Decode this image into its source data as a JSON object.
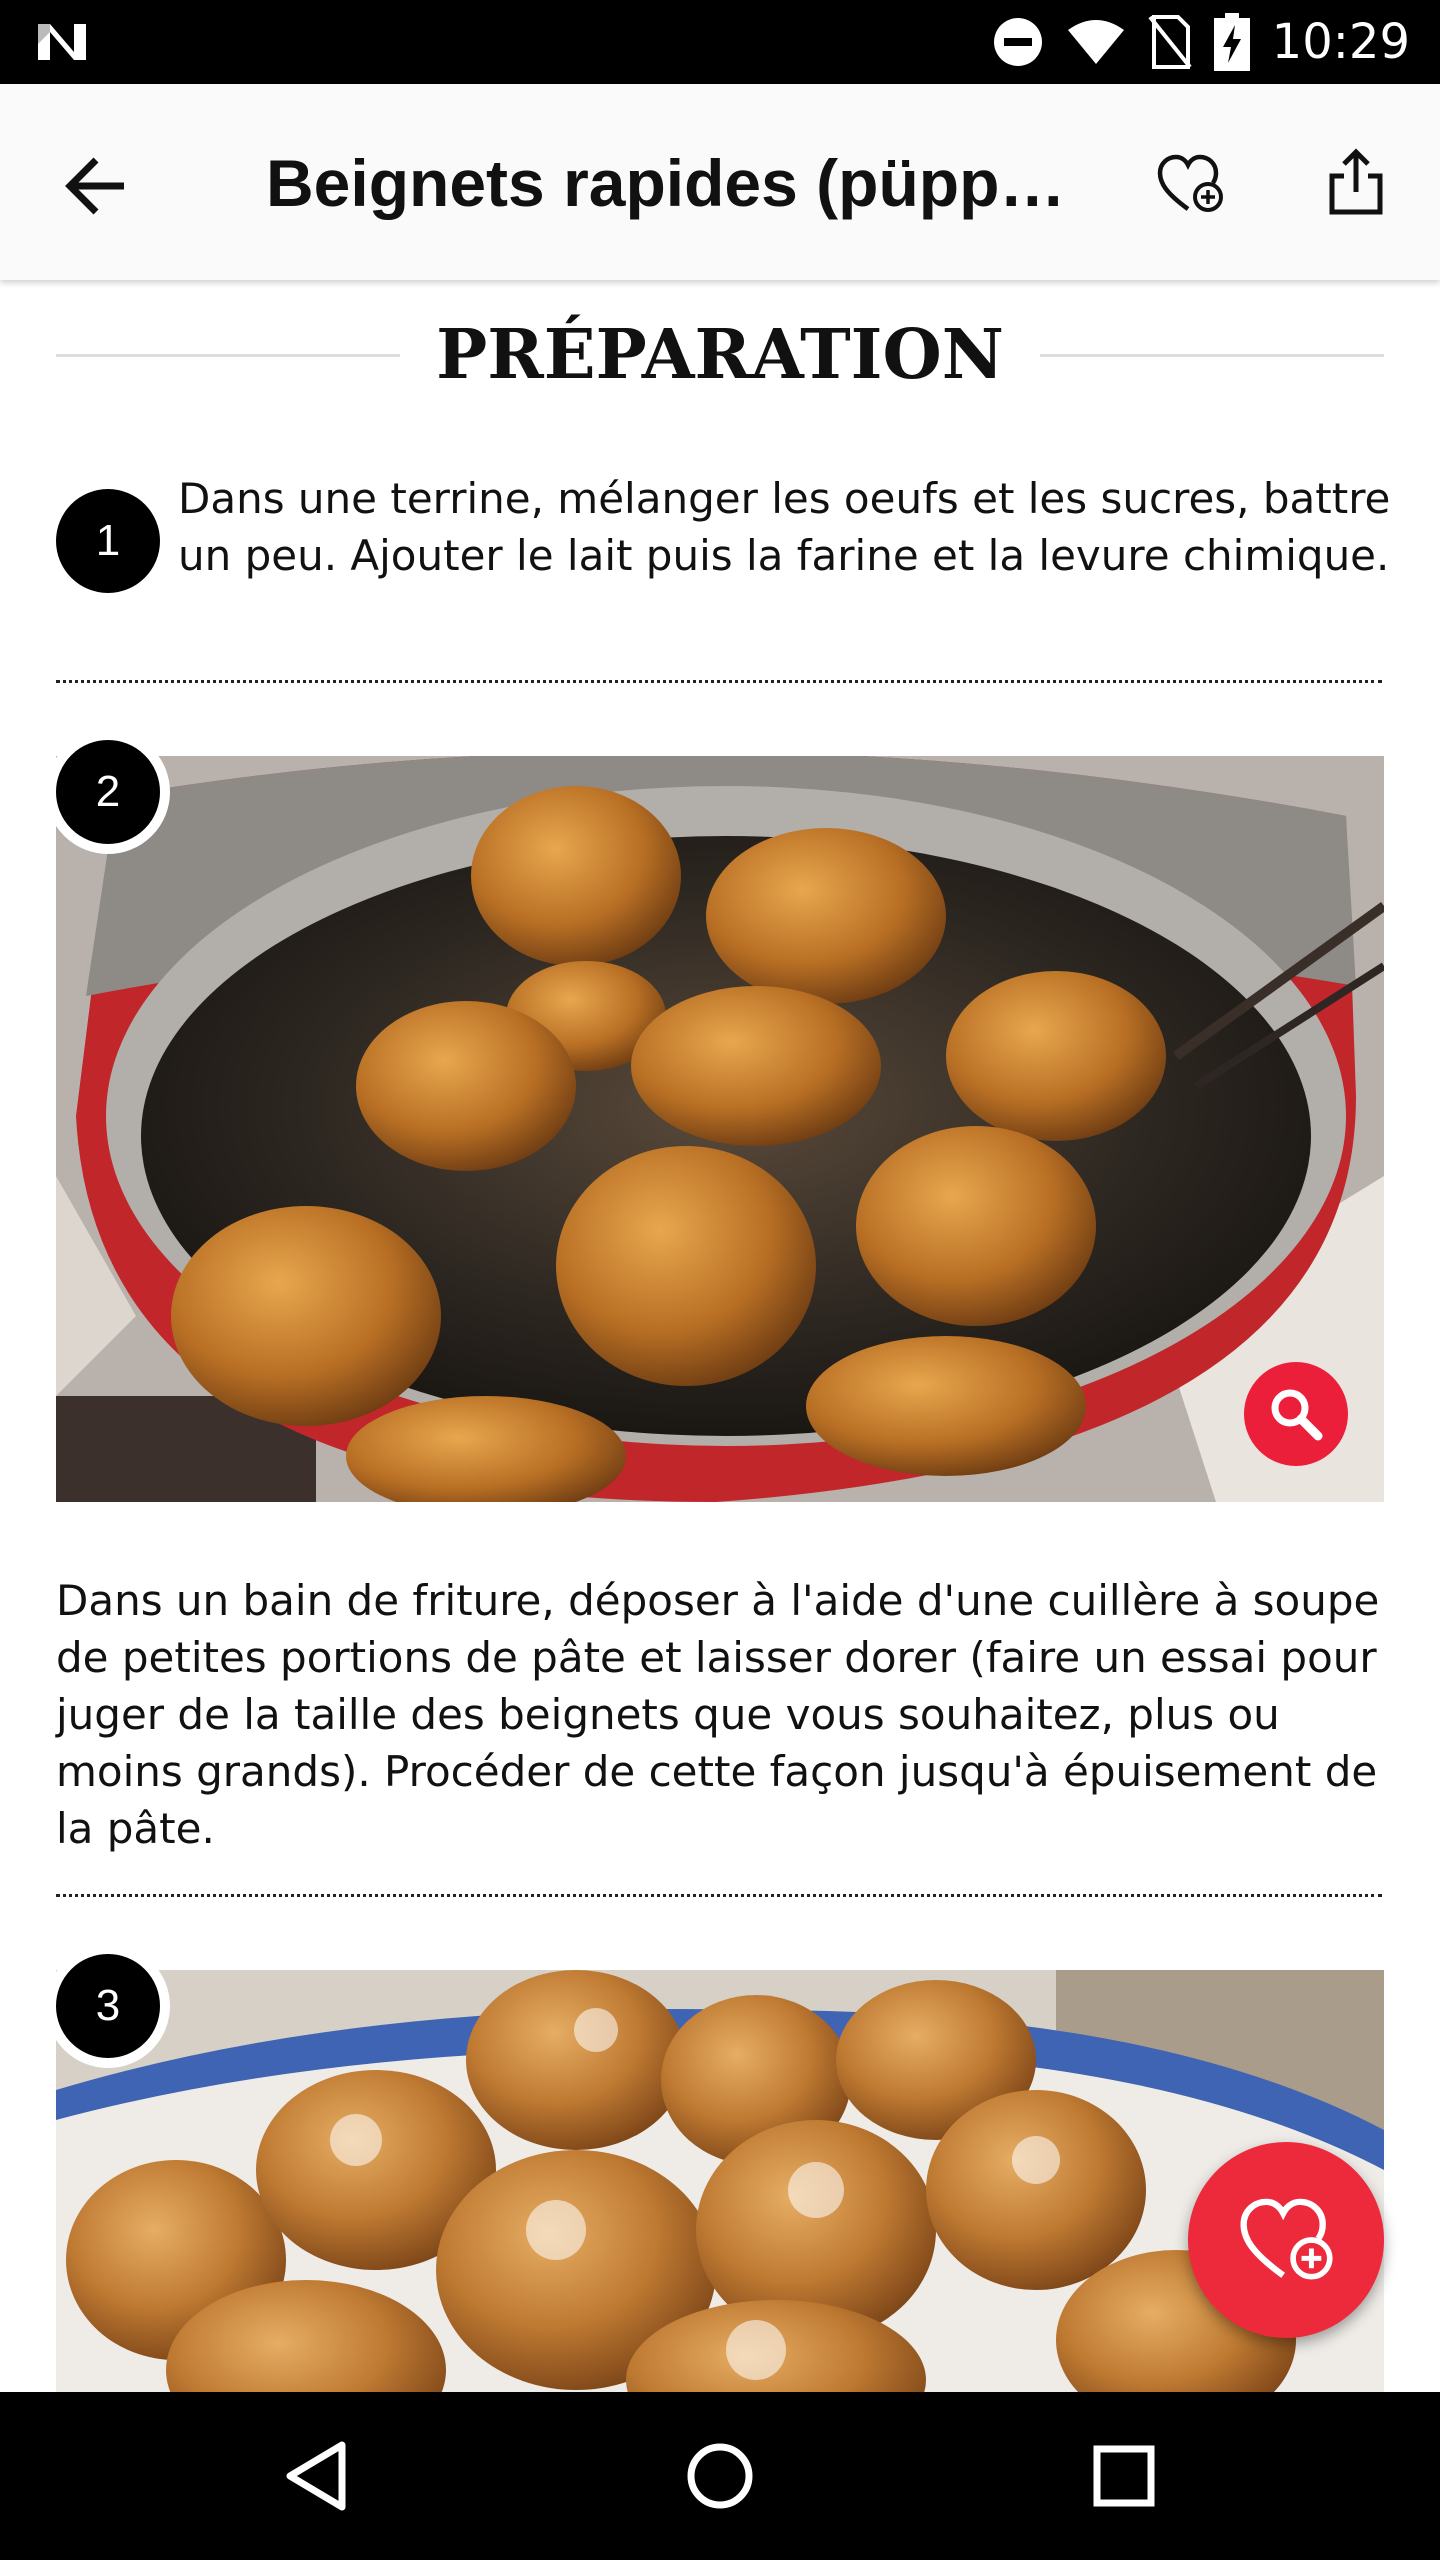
{
  "status_bar": {
    "time": "10:29",
    "icons": [
      "notification-n-icon",
      "dnd-icon",
      "wifi-icon",
      "no-sim-icon",
      "battery-charging-icon"
    ]
  },
  "app_bar": {
    "title": "Beignets rapides (püpper…",
    "back_icon": "arrow-back-icon",
    "favorite_icon": "heart-plus-icon",
    "share_icon": "share-icon"
  },
  "section": {
    "heading": "PRÉPARATION"
  },
  "steps": [
    {
      "number": "1",
      "text": "Dans une terrine, mélanger les oeufs et les sucres, battre un peu. Ajouter le lait puis la farine et la levure chimique."
    },
    {
      "number": "2",
      "image_alt": "beignets frying in oil in a red pot",
      "text": "Dans un bain de friture, déposer à l'aide d'une cuillère à soupe de petites portions de pâte et laisser dorer (faire un essai pour juger de la taille des beignets que vous souhaitez, plus ou moins grands). Procéder de cette façon jusqu'à épuisement de la pâte."
    },
    {
      "number": "3",
      "image_alt": "sugared beignets on a blue plate"
    }
  ],
  "colors": {
    "accent": "#ec2a3c",
    "status_bar": "#000000",
    "app_bar": "#fafafa"
  },
  "nav_bar": {
    "icons": [
      "back-triangle-icon",
      "home-circle-icon",
      "recents-square-icon"
    ]
  }
}
